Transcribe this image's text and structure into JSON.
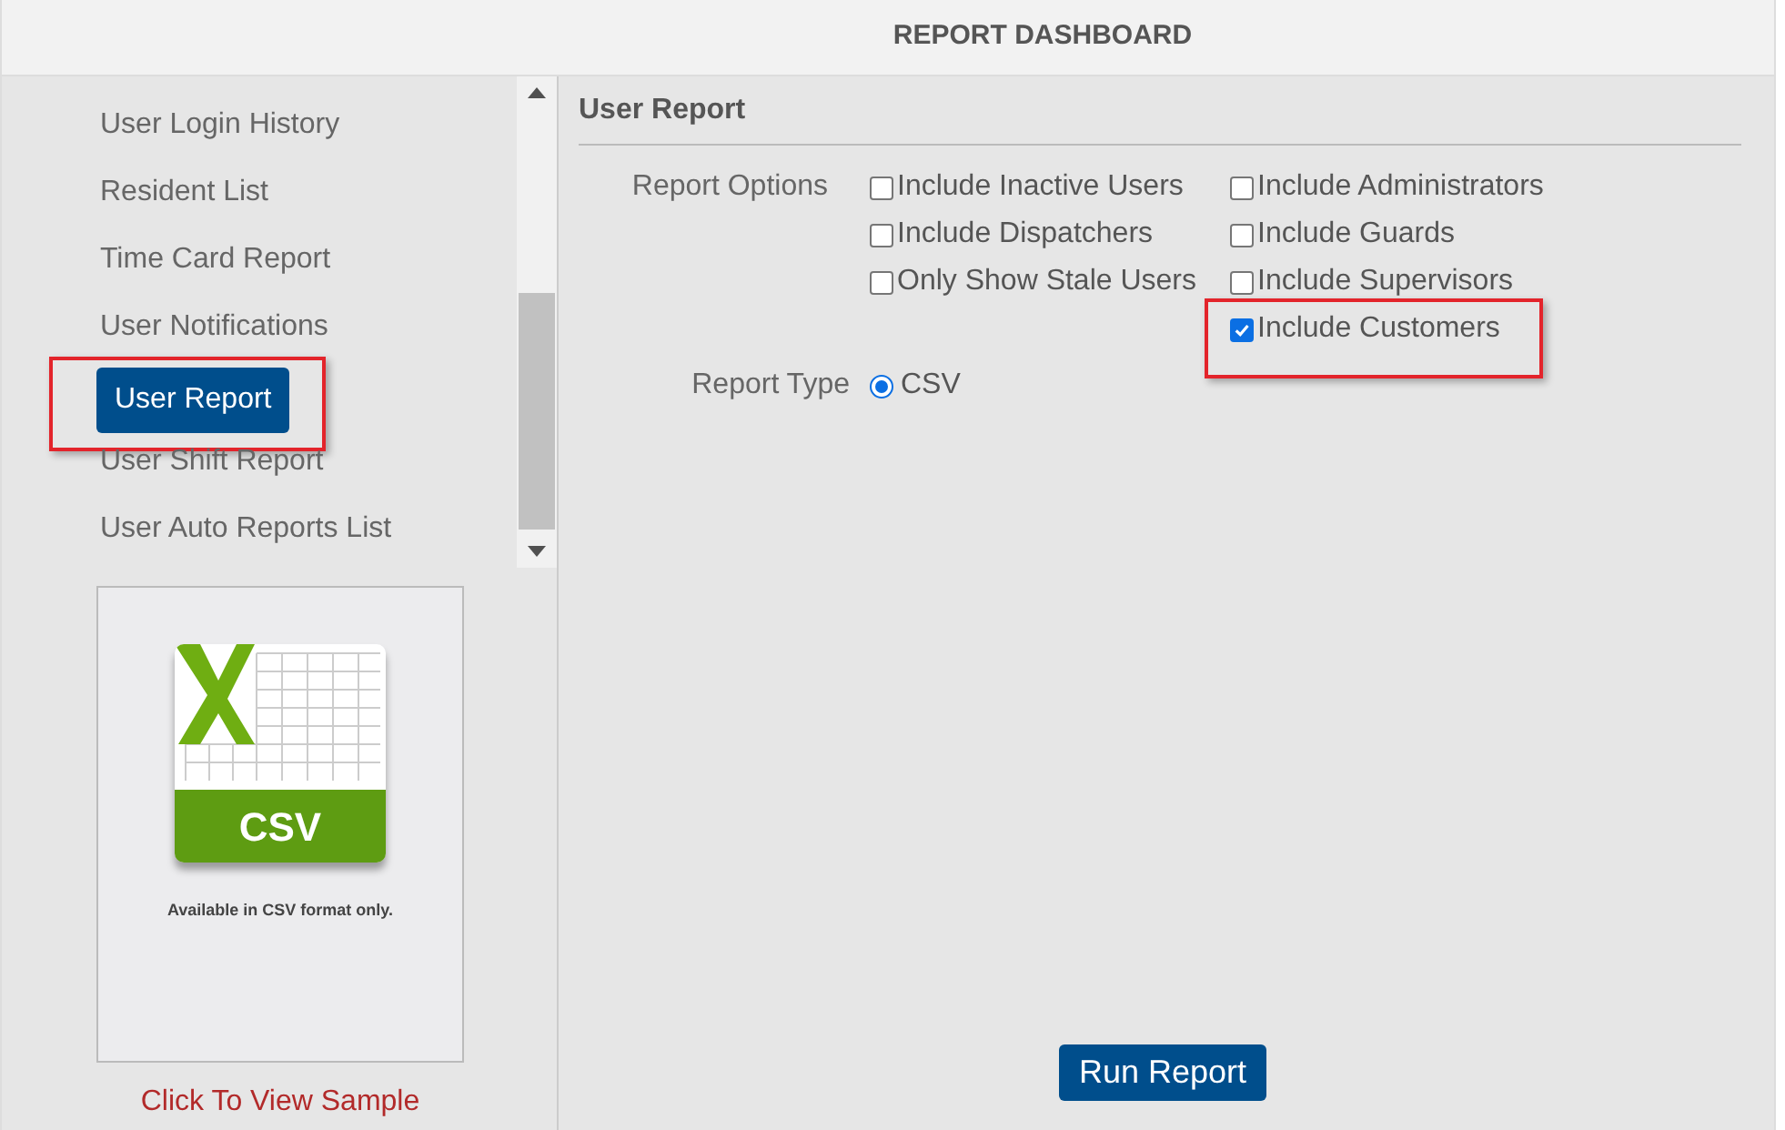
{
  "header": {
    "title": "REPORT DASHBOARD"
  },
  "sidebar": {
    "items": [
      {
        "label": "User Login History",
        "selected": false,
        "highlighted": false
      },
      {
        "label": "Resident List",
        "selected": false,
        "highlighted": false
      },
      {
        "label": "Time Card Report",
        "selected": false,
        "highlighted": false
      },
      {
        "label": "User Notifications",
        "selected": false,
        "highlighted": false
      },
      {
        "label": "User Report",
        "selected": true,
        "highlighted": true
      },
      {
        "label": "User Shift Report",
        "selected": false,
        "highlighted": false
      },
      {
        "label": "User Auto Reports List",
        "selected": false,
        "highlighted": false
      }
    ],
    "sample": {
      "badge": "CSV",
      "caption": "Available in CSV format only.",
      "link": "Click To View Sample"
    }
  },
  "panel": {
    "title": "User Report",
    "options_label": "Report Options",
    "options": [
      {
        "label": "Include Inactive Users",
        "checked": false,
        "highlighted": false
      },
      {
        "label": "Include Administrators",
        "checked": false,
        "highlighted": false
      },
      {
        "label": "Include Dispatchers",
        "checked": false,
        "highlighted": false
      },
      {
        "label": "Include Guards",
        "checked": false,
        "highlighted": false
      },
      {
        "label": "Only Show Stale Users",
        "checked": false,
        "highlighted": false
      },
      {
        "label": "Include Supervisors",
        "checked": false,
        "highlighted": false
      },
      {
        "label": "Include Customers",
        "checked": true,
        "highlighted": true
      }
    ],
    "type_label": "Report Type",
    "types": [
      {
        "label": "CSV",
        "selected": true
      }
    ],
    "run_button": "Run Report"
  }
}
